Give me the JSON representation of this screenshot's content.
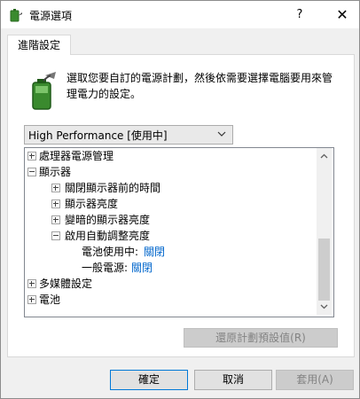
{
  "window": {
    "title": "電源選項",
    "help": "?",
    "close": "✕"
  },
  "tab": {
    "label": "進階設定"
  },
  "description": "選取您要自訂的電源計劃，然後依需要選擇電腦要用來管理電力的設定。",
  "plan_select": {
    "value": "High Performance [使用中]"
  },
  "tree": {
    "processor": "處理器電源管理",
    "display": "顯示器",
    "turn_off_after": "關閉顯示器前的時間",
    "brightness": "顯示器亮度",
    "dimmed_brightness": "變暗的顯示器亮度",
    "adaptive_brightness": "啟用自動調整亮度",
    "on_battery_label": "電池使用中:",
    "on_battery_value": "關閉",
    "plugged_in_label": "一般電源:",
    "plugged_in_value": "關閉",
    "multimedia": "多媒體設定",
    "battery": "電池"
  },
  "buttons": {
    "restore": "還原計劃預設值(R)",
    "ok": "確定",
    "cancel": "取消",
    "apply": "套用(A)"
  },
  "colors": {
    "link": "#0066cc",
    "focus_border": "#0078d7"
  }
}
